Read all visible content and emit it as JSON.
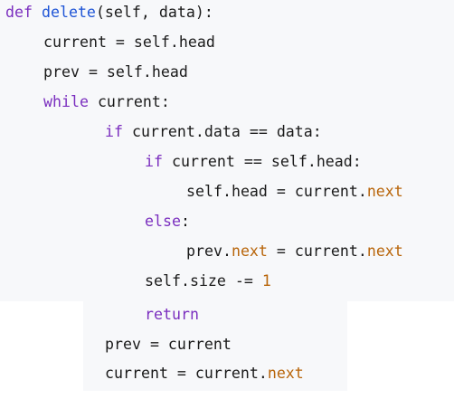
{
  "colors": {
    "background": "#f7f8fa",
    "text": "#1a1a1a",
    "keyword": "#7b2fbf",
    "function": "#1f55d6",
    "attribute": "#b8650a",
    "number": "#b8650a"
  },
  "code": {
    "line1": {
      "kw_def": "def",
      "fn_name": "delete",
      "rest": "(self, data):"
    },
    "line2": {
      "text": "current = self.head"
    },
    "line3": {
      "text": "prev = self.head"
    },
    "line4": {
      "kw_while": "while",
      "rest": " current:"
    },
    "line5": {
      "kw_if": "if",
      "rest": " current.data == data:"
    },
    "line6": {
      "kw_if": "if",
      "rest": " current == self.head:"
    },
    "line7": {
      "lhs": "self.head = current.",
      "attr": "next"
    },
    "line8": {
      "kw_else": "else",
      "rest": ":"
    },
    "line9": {
      "prev": "prev.",
      "attr1": "next",
      "mid": " = current.",
      "attr2": "next"
    },
    "line10": {
      "lhs": "self.size -= ",
      "num": "1"
    },
    "line11": {
      "kw_return": "return"
    },
    "line12": {
      "text": "prev = current"
    },
    "line13": {
      "lhs": "current = current.",
      "attr": "next"
    }
  }
}
